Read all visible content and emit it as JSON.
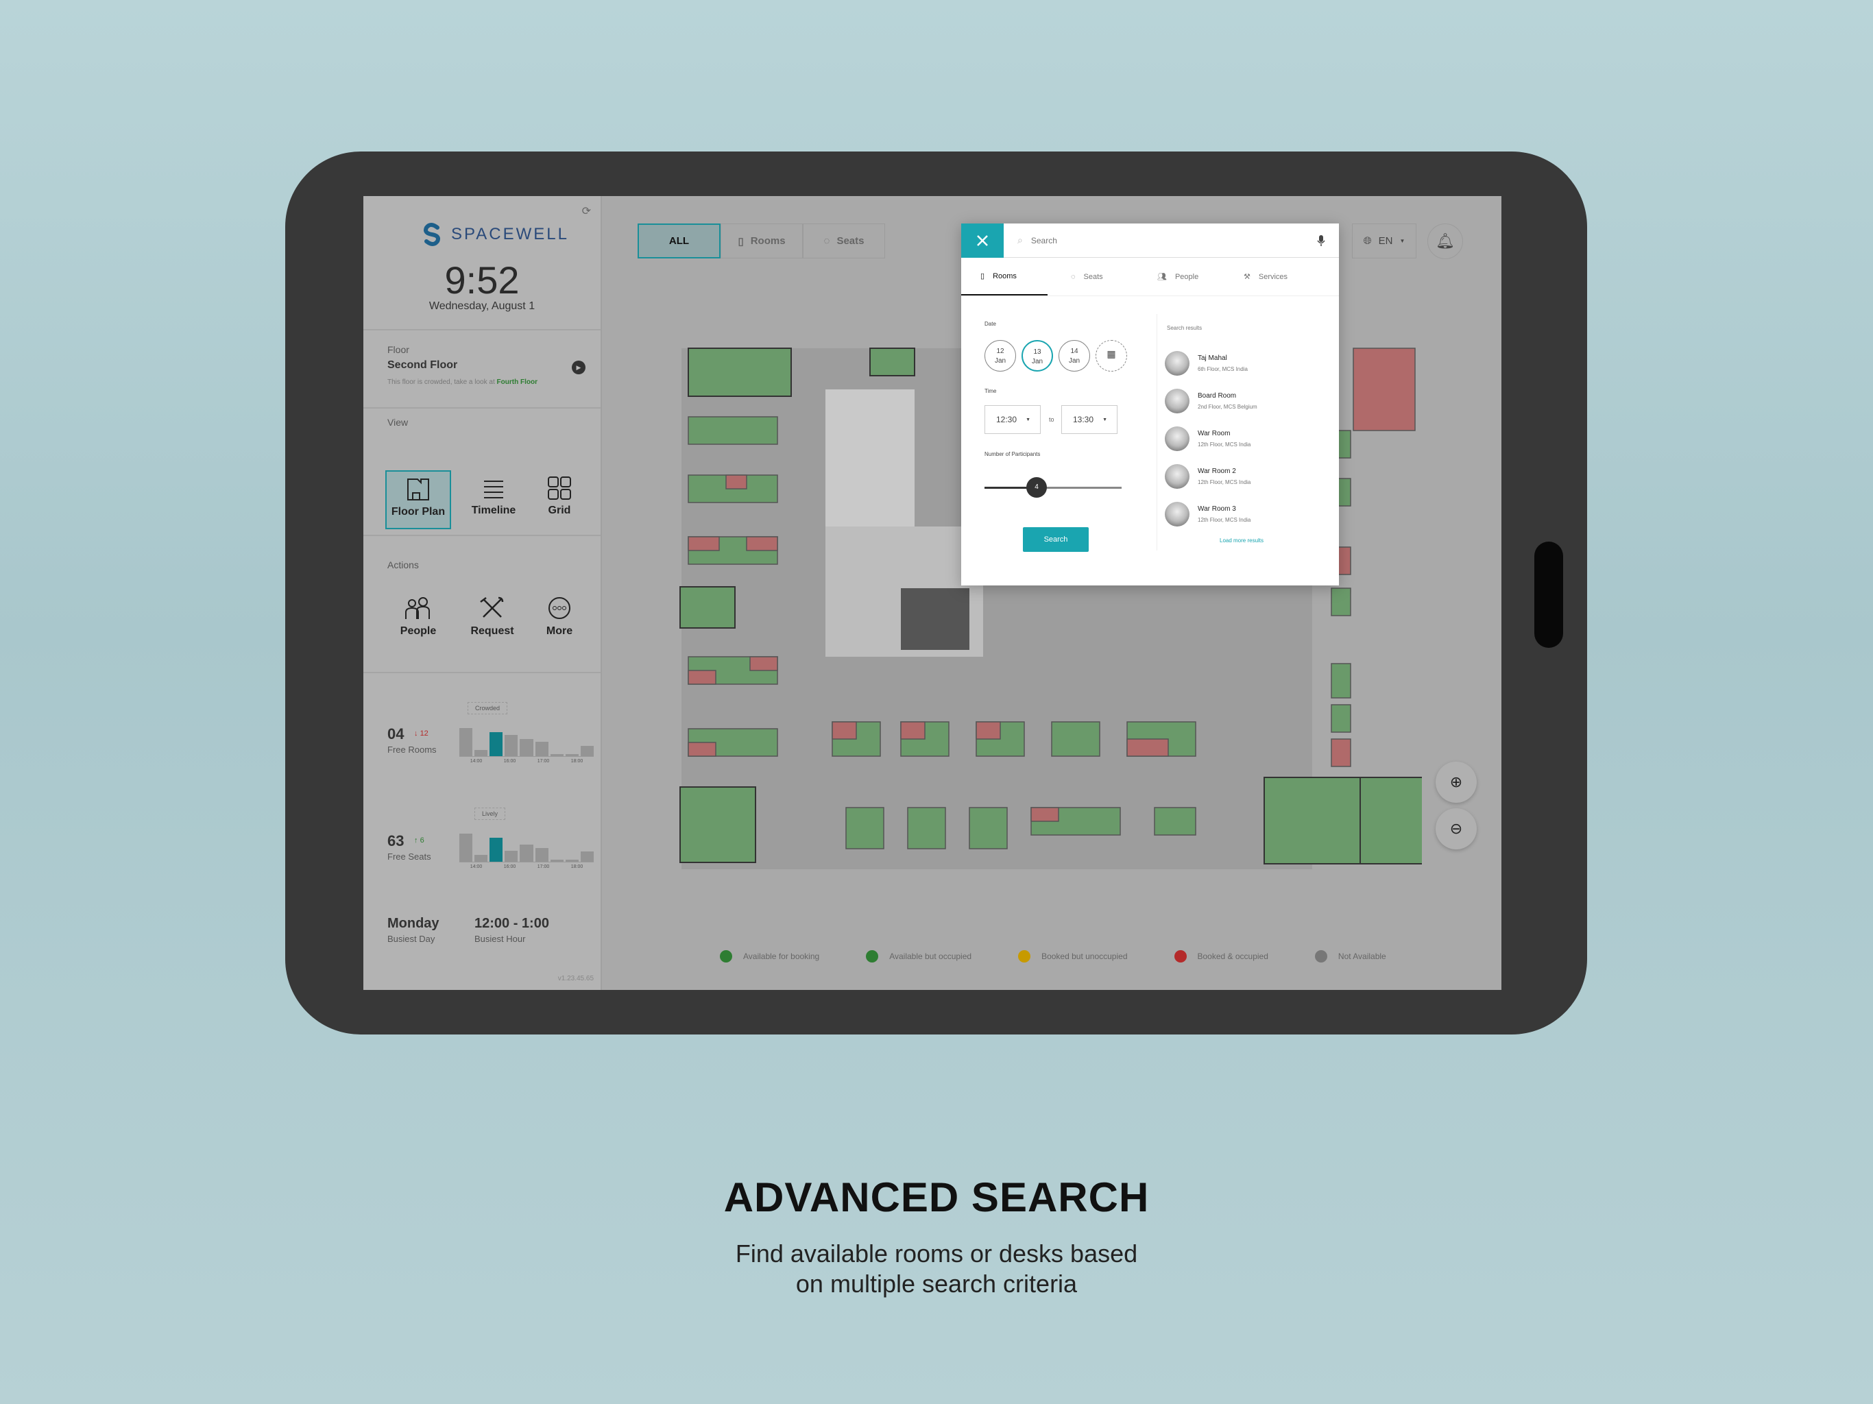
{
  "sidebar": {
    "brand": "SPACEWELL",
    "time": "9:52",
    "date": "Wednesday, August 1",
    "floor": {
      "label": "Floor",
      "name": "Second Floor",
      "hint": "This floor is crowded, take a look at ",
      "hint_link": "Fourth Floor"
    },
    "view": {
      "label": "View",
      "items": [
        {
          "label": "Floor Plan",
          "icon": "floor-plan-icon",
          "active": true
        },
        {
          "label": "Timeline",
          "icon": "lines-icon"
        },
        {
          "label": "Grid",
          "icon": "grid-icon"
        }
      ]
    },
    "actions": {
      "label": "Actions",
      "items": [
        {
          "label": "People",
          "icon": "people-icon"
        },
        {
          "label": "Request",
          "icon": "tools-icon"
        },
        {
          "label": "More",
          "icon": "more-icon"
        }
      ]
    },
    "stats": [
      {
        "value": "04",
        "delta": "12",
        "direction": "down",
        "label": "Free Rooms",
        "tag": "Crowded",
        "bars_pct": [
          100,
          22,
          85,
          75,
          62,
          52,
          7,
          7,
          37
        ],
        "highlight": 2,
        "ticks": [
          "14:00",
          "16:00",
          "17:00",
          "18:00"
        ]
      },
      {
        "value": "63",
        "delta": "6",
        "direction": "up",
        "label": "Free Seats",
        "tag": "Lively",
        "bars_pct": [
          100,
          24,
          85,
          38,
          62,
          50,
          8,
          8,
          37
        ],
        "highlight": 2,
        "ticks": [
          "14:00",
          "16:00",
          "17:00",
          "18:00"
        ]
      }
    ],
    "busiest": {
      "day": "Monday",
      "day_label": "Busiest Day",
      "hour": "12:00 - 1:00",
      "hour_label": "Busiest Hour"
    },
    "version": "v1.23.45.65"
  },
  "filter": {
    "all": "ALL",
    "rooms": "Rooms",
    "seats": "Seats",
    "active": "ALL"
  },
  "language": "EN",
  "search_panel": {
    "placeholder": "Search",
    "tabs": [
      {
        "label": "Rooms",
        "active": true
      },
      {
        "label": "Seats"
      },
      {
        "label": "People"
      },
      {
        "label": "Services"
      }
    ],
    "date_label": "Date",
    "dates": [
      {
        "day": "12",
        "month": "Jan"
      },
      {
        "day": "13",
        "month": "Jan",
        "selected": true
      },
      {
        "day": "14",
        "month": "Jan"
      }
    ],
    "time_label": "Time",
    "time_from": "12:30",
    "time_sep": "to",
    "time_to": "13:30",
    "participants_label": "Number of Participants",
    "participants": "4",
    "participants_fraction": 0.38,
    "search_button": "Search",
    "results_label": "Search results",
    "results": [
      {
        "name": "Taj Mahal",
        "location": "6th Floor, MCS India"
      },
      {
        "name": "Board Room",
        "location": "2nd Floor, MCS Belgium"
      },
      {
        "name": "War Room",
        "location": "12th Floor, MCS India"
      },
      {
        "name": "War Room 2",
        "location": "12th Floor, MCS India"
      },
      {
        "name": "War Room 3",
        "location": "12th Floor, MCS India"
      }
    ],
    "load_more": "Load more results"
  },
  "legend": [
    {
      "label": "Available for booking",
      "color": "#2e7d32"
    },
    {
      "label": "Available but occupied",
      "color": "#2e7d32"
    },
    {
      "label": "Booked but unoccupied",
      "color": "#c79a00"
    },
    {
      "label": "Booked & occupied",
      "color": "#b42a2a"
    },
    {
      "label": "Not Available",
      "color": "#777777"
    }
  ],
  "colors": {
    "accent": "#1aa5b0",
    "available": "#6aa56a",
    "booked": "#c07070"
  },
  "headline": "ADVANCED SEARCH",
  "subline1": "Find available rooms or desks based",
  "subline2": "on multiple search criteria"
}
